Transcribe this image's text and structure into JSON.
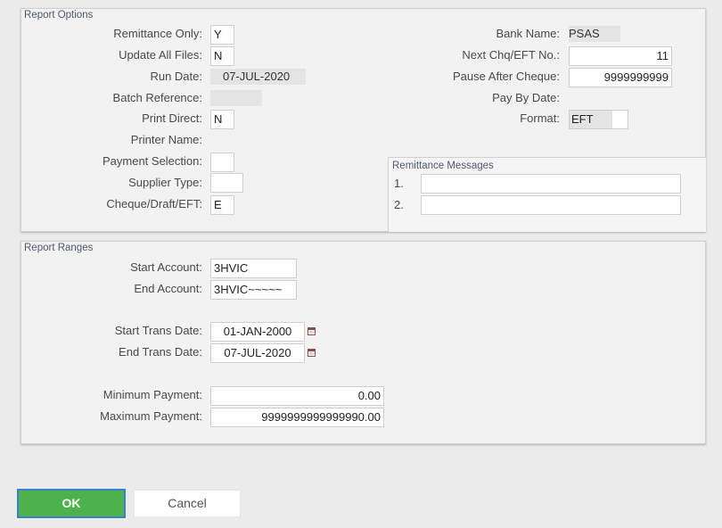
{
  "report_options": {
    "legend": "Report Options",
    "remittance_only": {
      "label": "Remittance Only:",
      "value": "Y"
    },
    "update_all_files": {
      "label": "Update All Files:",
      "value": "N"
    },
    "run_date": {
      "label": "Run Date:",
      "value": "07-JUL-2020"
    },
    "batch_reference": {
      "label": "Batch Reference:",
      "value": ""
    },
    "print_direct": {
      "label": "Print Direct:",
      "value": "N"
    },
    "printer_name": {
      "label": "Printer Name:",
      "value": ""
    },
    "payment_selection": {
      "label": "Payment Selection:",
      "value": ""
    },
    "supplier_type": {
      "label": "Supplier Type:",
      "value": ""
    },
    "cheque_draft_eft": {
      "label": "Cheque/Draft/EFT:",
      "value": "E"
    },
    "bank_name": {
      "label": "Bank Name:",
      "value": "PSAS"
    },
    "next_chq_eft_no": {
      "label": "Next Chq/EFT No.:",
      "value": "11"
    },
    "pause_after_cheque": {
      "label": "Pause After Cheque:",
      "value": "9999999999"
    },
    "pay_by_date": {
      "label": "Pay By Date:",
      "value": ""
    },
    "format": {
      "label": "Format:",
      "value": "EFT"
    }
  },
  "remittance_messages": {
    "legend": "Remittance Messages",
    "line1": {
      "label": "1.",
      "value": ""
    },
    "line2": {
      "label": "2.",
      "value": ""
    }
  },
  "report_ranges": {
    "legend": "Report Ranges",
    "start_account": {
      "label": "Start Account:",
      "value": "3HVIC"
    },
    "end_account": {
      "label": "End Account:",
      "value": "3HVIC~~~~~"
    },
    "start_trans_date": {
      "label": "Start Trans Date:",
      "value": "01-JAN-2000"
    },
    "end_trans_date": {
      "label": "End Trans Date:",
      "value": "07-JUL-2020"
    },
    "minimum_payment": {
      "label": "Minimum Payment:",
      "value": "0.00"
    },
    "maximum_payment": {
      "label": "Maximum Payment:",
      "value": "9999999999999990.00"
    }
  },
  "buttons": {
    "ok": "OK",
    "cancel": "Cancel"
  },
  "icons": {
    "calendar": "calendar-icon"
  },
  "colors": {
    "ok_button": "#4cb24c",
    "legend_text": "#505a6e",
    "calendar_icon": "#8a4a4a"
  }
}
